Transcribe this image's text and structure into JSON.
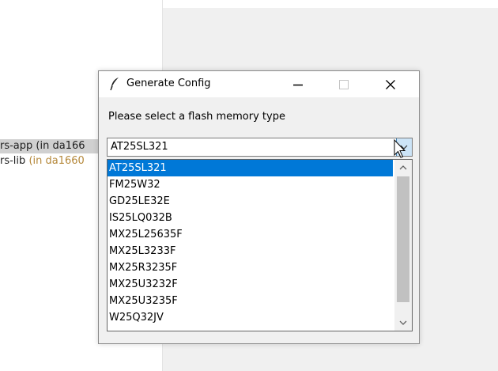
{
  "background": {
    "project_items": [
      {
        "name": "rs-app",
        "hint": "(in da166"
      },
      {
        "name": "rs-lib",
        "hint": "(in da1660"
      }
    ]
  },
  "dialog": {
    "title": "Generate Config",
    "title_icon": "feather-icon",
    "prompt": "Please select a flash memory type",
    "combo_value": "AT25SL321",
    "options": [
      "AT25SL321",
      "FM25W32",
      "GD25LE32E",
      "IS25LQ032B",
      "MX25L25635F",
      "MX25L3233F",
      "MX25R3235F",
      "MX25U3232F",
      "MX25U3235F",
      "W25Q32JV"
    ],
    "selected_index": 0
  },
  "colors": {
    "selection": "#0078d7",
    "dropdown_button": "#cce4f7"
  }
}
